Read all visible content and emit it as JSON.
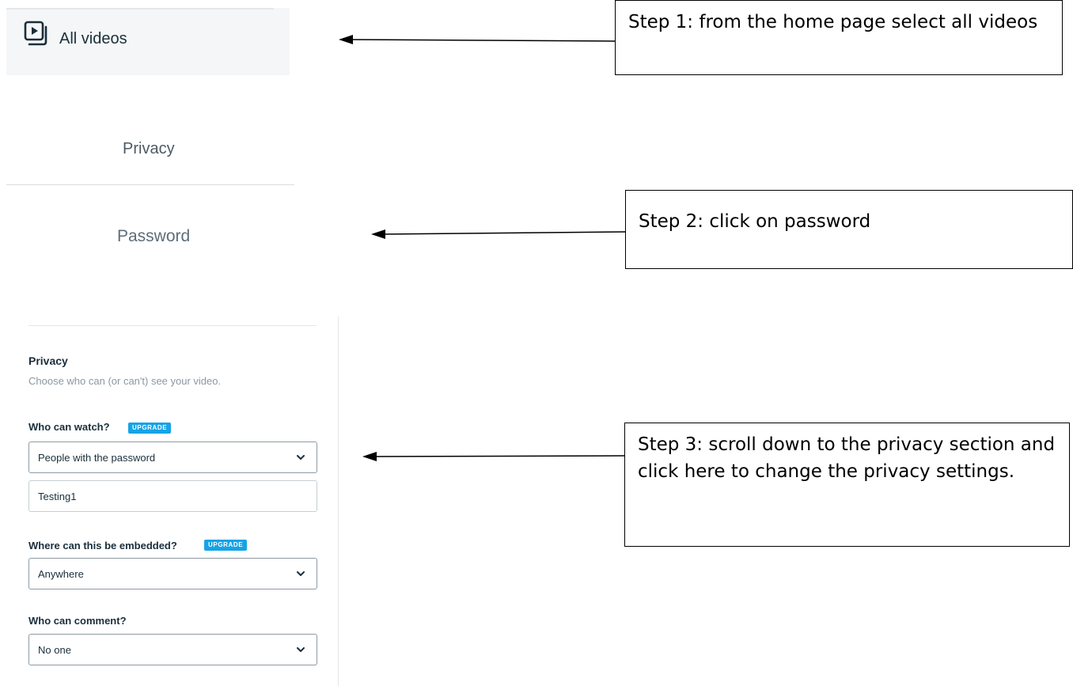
{
  "section1": {
    "label": "All videos",
    "icon": "video-library-icon"
  },
  "section2": {
    "tab_privacy": "Privacy",
    "tab_password": "Password"
  },
  "callouts": {
    "step1": "Step 1: from the home page select all videos",
    "step2": "Step 2: click on password",
    "step3": "Step 3: scroll down to the privacy section and click here to change the privacy settings."
  },
  "privacy": {
    "heading": "Privacy",
    "description": "Choose who can (or can't) see your video.",
    "watch_label": "Who can watch?",
    "watch_badge": "UPGRADE",
    "watch_value": "People with the password",
    "password_value": "Testing1",
    "embed_label": "Where can this be embedded?",
    "embed_badge": "UPGRADE",
    "embed_value": "Anywhere",
    "comment_label": "Who can comment?",
    "comment_value": "No one"
  },
  "colors": {
    "badge": "#16a3e6",
    "text": "#1a2e3b",
    "muted": "#8a98a3"
  }
}
